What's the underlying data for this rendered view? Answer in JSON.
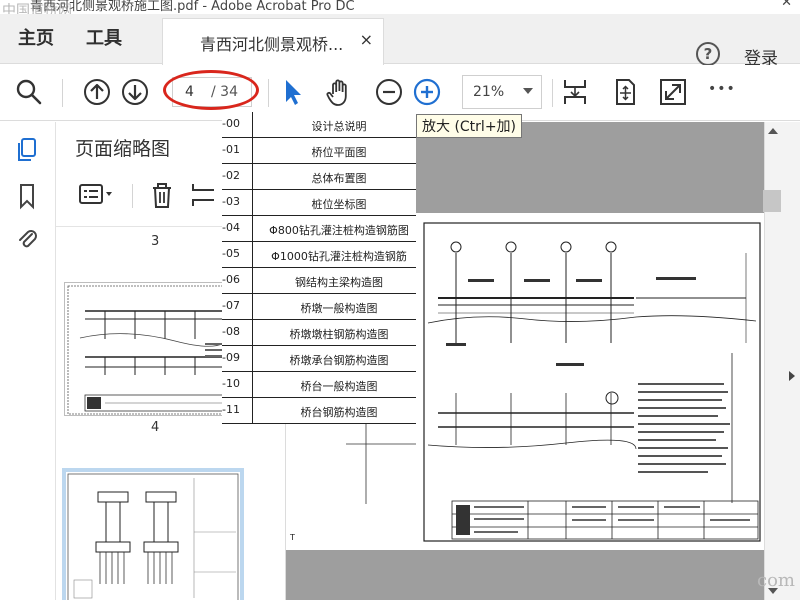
{
  "window": {
    "title": "青西河北侧景观桥施工图.pdf - Adobe Acrobat Pro DC",
    "close_glyph": "✕",
    "watermark": "中国道桥网",
    "watermark_suffix": "com"
  },
  "nav": {
    "home_label": "主页",
    "tools_label": "工具",
    "doc_tab_label": "青西河北侧景观桥...",
    "doc_tab_close": "×",
    "help_glyph": "?",
    "login_label": "登录"
  },
  "toolbar": {
    "current_page": "4",
    "total_pages": "/ 34",
    "zoom_value": "21%",
    "more_glyph": "•••",
    "tooltip": "放大 (Ctrl+加)"
  },
  "icons": {
    "search": "search-icon",
    "page_up": "arrow-up-circle-icon",
    "page_down": "arrow-down-circle-icon",
    "select": "cursor-arrow-icon",
    "hand": "hand-icon",
    "zoom_out": "zoom-out-icon",
    "zoom_in": "zoom-in-icon",
    "fit_page": "fit-page-icon",
    "scroll_mode": "scroll-mode-icon",
    "full_screen": "full-screen-icon",
    "thumbnails": "page-thumbnails-icon",
    "bookmarks": "bookmark-icon",
    "attachments": "paperclip-icon",
    "options": "thumbnail-options-icon",
    "delete": "trash-icon",
    "insert": "insert-page-icon"
  },
  "panel": {
    "title": "页面缩略图",
    "labels": [
      "3",
      "4"
    ]
  },
  "index_table": {
    "rows": [
      {
        "code": "-00",
        "name": "设计总说明"
      },
      {
        "code": "-01",
        "name": "桥位平面图"
      },
      {
        "code": "-02",
        "name": "总体布置图"
      },
      {
        "code": "-03",
        "name": "桩位坐标图"
      },
      {
        "code": "-04",
        "name": "Φ800钻孔灌注桩构造钢筋图"
      },
      {
        "code": "-05",
        "name": "Φ1000钻孔灌注桩构造钢筋"
      },
      {
        "code": "-06",
        "name": "钢结构主梁构造图"
      },
      {
        "code": "-07",
        "name": "桥墩一般构造图"
      },
      {
        "code": "-08",
        "name": "桥墩墩柱钢筋构造图"
      },
      {
        "code": "-09",
        "name": "桥墩承台钢筋构造图"
      },
      {
        "code": "-10",
        "name": "桥台一般构造图"
      },
      {
        "code": "-11",
        "name": "桥台钢筋构造图"
      }
    ]
  },
  "colors": {
    "annotation_ring": "#d9261c",
    "accent_blue": "#1f6fd1",
    "doc_background": "#9e9e9e",
    "thumb_selected": "#bcd7ef"
  }
}
